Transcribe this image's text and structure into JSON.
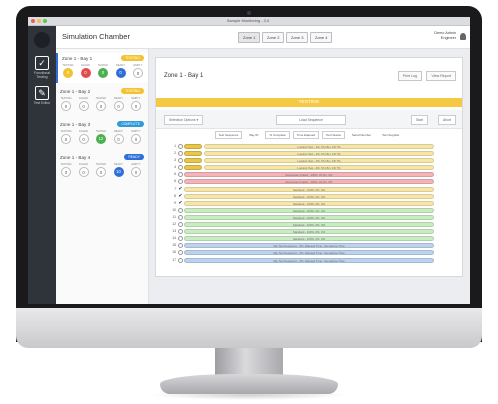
{
  "window": {
    "title": "Sample Monitoring - 3.0"
  },
  "rail": {
    "items": [
      {
        "icon": "checkbox-icon",
        "label": "Functional Testing",
        "glyph": "✓"
      },
      {
        "icon": "edit-icon",
        "label": "Test Editor",
        "glyph": "✎"
      }
    ]
  },
  "header": {
    "title": "Simulation Chamber",
    "tabs": [
      "Zone 1",
      "Zone 2",
      "Zone 3",
      "Zone 4"
    ],
    "active_tab": 0,
    "user": {
      "line1": "Demo Admin",
      "line2": "Engineer"
    }
  },
  "zones": [
    {
      "name": "Zone 1 - Bay 1",
      "badge": "TESTING",
      "badge_color": "#f2c230",
      "labels": [
        "TESTING",
        "FAILED",
        "TESTED",
        "READY",
        "EMPTY"
      ],
      "counts": [
        "6",
        "0",
        "0",
        "0",
        "0"
      ],
      "colors": [
        "#f2c230",
        "#e24b4b",
        "#4caf50",
        "#2e6fd8",
        "#ffffff"
      ]
    },
    {
      "name": "Zone 1 - Bay 2",
      "badge": "TESTING",
      "badge_color": "#f2c230",
      "labels": [
        "TESTING",
        "FAILED",
        "TESTED",
        "READY",
        "EMPTY"
      ],
      "counts": [
        "0",
        "0",
        "0",
        "0",
        "0"
      ],
      "colors": [
        "#ffffff",
        "#ffffff",
        "#ffffff",
        "#ffffff",
        "#ffffff"
      ]
    },
    {
      "name": "Zone 1 - Bay 3",
      "badge": "COMPLETE",
      "badge_color": "#2e9bd8",
      "labels": [
        "TESTING",
        "FAILED",
        "TESTED",
        "READY",
        "EMPTY"
      ],
      "counts": [
        "0",
        "0",
        "12",
        "0",
        "0"
      ],
      "colors": [
        "#ffffff",
        "#ffffff",
        "#4caf50",
        "#ffffff",
        "#ffffff"
      ]
    },
    {
      "name": "Zone 1 - Bay 4",
      "badge": "READY",
      "badge_color": "#2e6fd8",
      "labels": [
        "TESTING",
        "FAILED",
        "TESTED",
        "READY",
        "EMPTY"
      ],
      "counts": [
        "0",
        "0",
        "0",
        "10",
        "0"
      ],
      "colors": [
        "#ffffff",
        "#ffffff",
        "#ffffff",
        "#2e6fd8",
        "#ffffff"
      ]
    }
  ],
  "panel": {
    "title": "Zone 1 - Bay 1",
    "buttons": [
      "Print Log",
      "View Report"
    ],
    "status": "TESTING",
    "controls": {
      "select": "Selection Options",
      "center": "Load Sequence",
      "right": [
        "Start",
        "Abort"
      ]
    },
    "filters": [
      {
        "label": "Test Sequence",
        "boxed": true
      },
      {
        "label": "Bay ID",
        "boxed": false
      },
      {
        "label": "% Complete",
        "boxed": true
      },
      {
        "label": "Time Elapsed",
        "boxed": true
      },
      {
        "label": "Test Status",
        "boxed": true
      },
      {
        "label": "Serial Number",
        "boxed": false
      },
      {
        "label": "Test Supplier",
        "boxed": false
      }
    ],
    "rows": [
      {
        "num": "1",
        "status": "running",
        "color": "#f6e7a9",
        "text": "Logging Test - 0%, 5h 15m, Fill 7%"
      },
      {
        "num": "2",
        "status": "running",
        "color": "#f6e7a9",
        "text": "Logging Test - 0%, 5h 15m, Fill 7%"
      },
      {
        "num": "3",
        "status": "running",
        "color": "#f6e7a9",
        "text": "Logging Test - 0%, 5h 15m, Fill 7%"
      },
      {
        "num": "4",
        "status": "running",
        "color": "#f6e7a9",
        "text": "Logging Test - 0%, 5h 15m, Fill 7%"
      },
      {
        "num": "5",
        "status": "failed",
        "color": "#f4b3b8",
        "text": "Regression Failed - 100%, 0h 0m, 0%"
      },
      {
        "num": "6",
        "status": "failed",
        "color": "#f4b3b8",
        "text": "Regression Failed - 100%, 0h 0m, 0%"
      },
      {
        "num": "7",
        "status": "done",
        "color": "#f6e7a9",
        "text": "Standard - 100%, 0%, 3%"
      },
      {
        "num": "8",
        "status": "done",
        "color": "#f6e7a9",
        "text": "Standard - 100%, 0%, 3%"
      },
      {
        "num": "9",
        "status": "done",
        "color": "#f6e7a9",
        "text": "Standard - 100%, 0%, 3%"
      },
      {
        "num": "10",
        "status": "idle",
        "color": "#c9ecc3",
        "text": "Standard - 100%, 0%, 3%"
      },
      {
        "num": "11",
        "status": "idle",
        "color": "#c9ecc3",
        "text": "Standard - 100%, 0%, 3%"
      },
      {
        "num": "12",
        "status": "idle",
        "color": "#c9ecc3",
        "text": "Standard - 100%, 0%, 3%"
      },
      {
        "num": "13",
        "status": "idle",
        "color": "#c9ecc3",
        "text": "Standard - 100%, 0%, 3%"
      },
      {
        "num": "14",
        "status": "idle",
        "color": "#c9ecc3",
        "text": "Standard - 100%, 0%, 3%"
      },
      {
        "num": "15",
        "status": "idle",
        "color": "#bcd3ef",
        "text": "Idle Test Sequence - 0%, Elapsed Time - Remaining Time"
      },
      {
        "num": "16",
        "status": "idle",
        "color": "#bcd3ef",
        "text": "Idle Test Sequence - 0%, Elapsed Time - Remaining Time"
      },
      {
        "num": "17",
        "status": "idle",
        "color": "#bcd3ef",
        "text": "Idle Test Sequence - 0%, Elapsed Time - Remaining Time"
      }
    ]
  }
}
